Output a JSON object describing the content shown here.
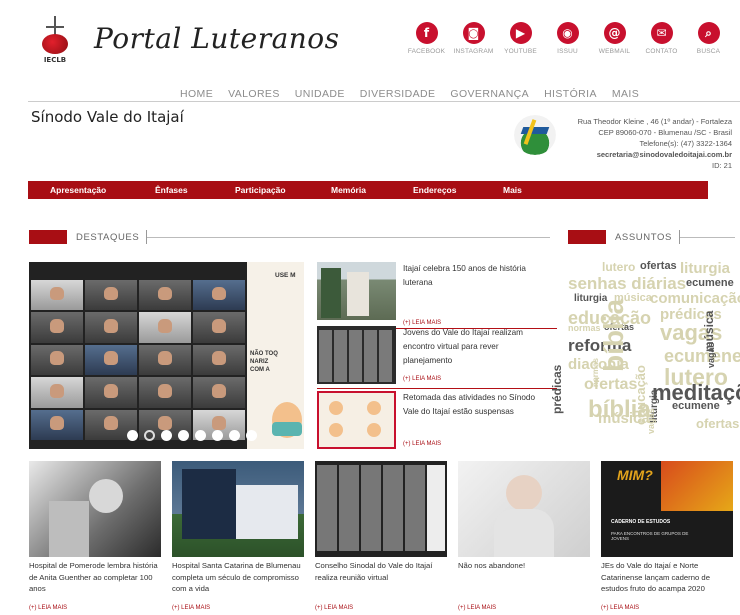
{
  "brand": {
    "logo_text": "IECLB",
    "name": "Portal Luteranos"
  },
  "social": [
    {
      "label": "FACEBOOK",
      "icon": "facebook-icon",
      "glyph": "f"
    },
    {
      "label": "INSTAGRAM",
      "icon": "instagram-icon",
      "glyph": "◙"
    },
    {
      "label": "YOUTUBE",
      "icon": "youtube-icon",
      "glyph": "▶"
    },
    {
      "label": "ISSUU",
      "icon": "issuu-icon",
      "glyph": "◉"
    },
    {
      "label": "WEBMAIL",
      "icon": "webmail-icon",
      "glyph": "@"
    },
    {
      "label": "CONTATO",
      "icon": "contact-icon",
      "glyph": "✉"
    },
    {
      "label": "BUSCA",
      "icon": "search-icon",
      "glyph": "⌕"
    }
  ],
  "topnav": [
    "HOME",
    "VALORES",
    "UNIDADE",
    "DIVERSIDADE",
    "GOVERNANÇA",
    "HISTÓRIA",
    "MAIS"
  ],
  "sinodo": {
    "title": "Sínodo Vale do Itajaí",
    "address_1": "Rua Theodor Kleine , 46 (1º andar) - Fortaleza",
    "address_2": "CEP 89060-070 - Blumenau /SC - Brasil",
    "phone": "Telefone(s): (47) 3322-1364",
    "email": "secretaria@sinodovaledoitajai.com.br",
    "id": "ID: 21"
  },
  "redmenu": [
    "Apresentação",
    "Ênfases",
    "Participação",
    "Memória",
    "Endereços",
    "Mais"
  ],
  "sections": {
    "highlights": "DESTAQUES",
    "topics": "ASSUNTOS"
  },
  "slider": {
    "side_top": "USE M",
    "side_warn": "NÃO TOQ\nNARIZ\nCOM A",
    "dot_count": 8,
    "active_dot": 1
  },
  "news": [
    {
      "title": "Itajaí celebra 150 anos de história luterana",
      "more": "(+) LEIA MAIS"
    },
    {
      "title": "Jovens do Vale do Itajaí realizam encontro virtual para rever planejamento",
      "more": "(+) LEIA MAIS"
    },
    {
      "title": "Retomada das atividades no Sínodo Vale do Itajaí estão suspensas",
      "more": "(+) LEIA MAIS"
    }
  ],
  "cloud": [
    {
      "w": "lutero",
      "c": "#d6d3b0"
    },
    {
      "w": "ofertas",
      "c": "#555"
    },
    {
      "w": "liturgia",
      "c": "#d6d3b0"
    },
    {
      "w": "senhas diárias",
      "c": "#d6d3b0"
    },
    {
      "w": "ecumene",
      "c": "#555"
    },
    {
      "w": "liturgia",
      "c": "#555"
    },
    {
      "w": "música",
      "c": "#d6d3b0"
    },
    {
      "w": "comunicação",
      "c": "#d6d3b0"
    },
    {
      "w": "educação",
      "c": "#d6d3b0"
    },
    {
      "w": "prédicas",
      "c": "#d6d3b0"
    },
    {
      "w": "normas",
      "c": "#d6d3b0"
    },
    {
      "w": "ofertas",
      "c": "#555"
    },
    {
      "w": "vagas",
      "c": "#d6d3b0"
    },
    {
      "w": "reforma",
      "c": "#555"
    },
    {
      "w": "bíblia",
      "c": "#d6d3b0"
    },
    {
      "w": "ecumene",
      "c": "#d6d3b0"
    },
    {
      "w": "música",
      "c": "#555"
    },
    {
      "w": "vagas",
      "c": "#555"
    },
    {
      "w": "diaconia",
      "c": "#d6d3b0"
    },
    {
      "w": "normas",
      "c": "#d6d3b0"
    },
    {
      "w": "lutero",
      "c": "#d6d3b0"
    },
    {
      "w": "ofertas",
      "c": "#d6d3b0"
    },
    {
      "w": "prédicas",
      "c": "#555"
    },
    {
      "w": "meditações",
      "c": "#555"
    },
    {
      "w": "bíblia",
      "c": "#d6d3b0"
    },
    {
      "w": "educação",
      "c": "#d6d3b0"
    },
    {
      "w": "ecumene",
      "c": "#555"
    },
    {
      "w": "liturgia",
      "c": "#555"
    },
    {
      "w": "música",
      "c": "#d6d3b0"
    },
    {
      "w": "vagas",
      "c": "#d6d3b0"
    },
    {
      "w": "ofertas",
      "c": "#d6d3b0"
    }
  ],
  "cards": [
    {
      "title": "Hospital de Pomerode lembra história de Anita Guenther ao completar 100 anos",
      "more": "(+) LEIA MAIS"
    },
    {
      "title": "Hospital Santa Catarina de Blumenau completa um século de compromisso com a vida",
      "more": "(+) LEIA MAIS"
    },
    {
      "title": "Conselho Sinodal do Vale do Itajaí realiza reunião virtual",
      "more": "(+) LEIA MAIS"
    },
    {
      "title": "Não nos abandone!",
      "more": "(+) LEIA MAIS"
    },
    {
      "title": "JEs do Vale do Itajaí e Norte Catarinense lançam caderno de estudos fruto do acampa 2020",
      "more": "(+) LEIA MAIS",
      "img_text_1": "MIM?",
      "img_text_2": "CADERNO DE ESTUDOS",
      "img_text_3": "PARA ENCONTROS DE GRUPOS DE JOVENS"
    }
  ],
  "colors": {
    "accent": "#a80e14",
    "social": "#c8102e"
  }
}
